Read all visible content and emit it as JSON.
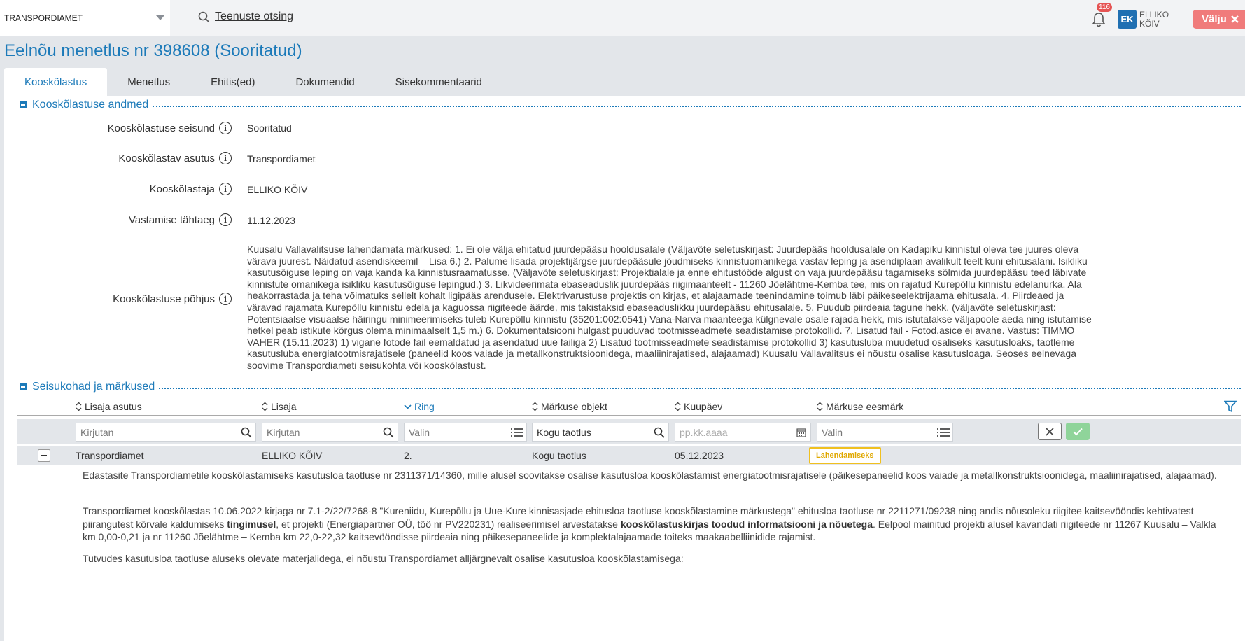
{
  "topbar": {
    "organization": "TRANSPORDIAMET",
    "search_label": "Teenuste otsing",
    "notifications_count": "116",
    "avatar_initials": "EK",
    "user_first": "ELLIKO",
    "user_last": "KÕIV",
    "logout_label": "Välju"
  },
  "page": {
    "title": "Eelnõu menetlus nr 398608 (Sooritatud)"
  },
  "tabs": [
    {
      "label": "Kooskõlastus",
      "active": true
    },
    {
      "label": "Menetlus"
    },
    {
      "label": "Ehitis(ed)"
    },
    {
      "label": "Dokumendid"
    },
    {
      "label": "Sisekommentaarid"
    }
  ],
  "section1": {
    "title": "Kooskõlastuse andmed",
    "fields": [
      {
        "label": "Kooskõlastuse seisund",
        "value": "Sooritatud"
      },
      {
        "label": "Kooskõlastav asutus",
        "value": "Transpordiamet"
      },
      {
        "label": "Kooskõlastaja",
        "value": "ELLIKO KÕIV"
      },
      {
        "label": "Vastamise tähtaeg",
        "value": "11.12.2023"
      },
      {
        "label": "Kooskõlastuse põhjus",
        "value": "Kuusalu Vallavalitsuse lahendamata märkused: 1. Ei ole välja ehitatud juurdepääsu hooldusalale (Väljavõte seletuskirjast: Juurdepääs hooldusalale on Kadapiku kinnistul oleva tee juures oleva värava juurest. Näidatud asendiskeemil – Lisa 6.) 2. Palume lisada projektijärgse juurdepääsule jõudmiseks kinnistuomanikega vastav leping ja asendiplaan avalikult teelt kuni ehitusalani. Isikliku kasutusõiguse leping on vaja kanda ka kinnistusraamatusse. (Väljavõte seletuskirjast: Projektialale ja enne ehitustööde algust on vaja juurdepääsu tagamiseks sõlmida juurdepääsu teed läbivate kinnistute omanikega isikliku kasutusõiguse lepingud.) 3. Likvideerimata ebaseaduslik juurdepääs riigimaanteelt - 11260 Jõelähtme-Kemba tee, mis on rajatud Kurepõllu kinnistu edelanurka. Ala heakorrastada ja teha võimatuks sellelt kohalt ligipääs arendusele. Elektrivarustuse projektis on kirjas, et alajaamade teenindamine toimub läbi päikeseelektrijaama ehitusala. 4. Piirdeaed ja väravad rajamata Kurepõllu kinnistu edela ja kaguossa riigiteede äärde, mis takistaksid ebaseaduslikku juurdepääsu ehitusalale. 5. Puudub piirdeaia tagune hekk. (väljavõte seletuskirjast: Potentsiaalse visuaalse häiringu minimeerimiseks tuleb Kurepõllu kinnistu (35201:002:0541) Vana-Narva maanteega külgnevale osale rajada hekk, mis istutatakse väljapoole aeda ning istutamise hetkel peab istikute kõrgus olema minimaalselt 1,5 m.) 6. Dokumentatsiooni hulgast puuduvad tootmisseadmete seadistamise protokollid. 7. Lisatud fail - Fotod.asice ei avane. Vastus: TIMMO VAHER (15.11.2023) 1) vigane fotode fail eemaldatud ja asendatud uue failiga 2) Lisatud tootmisseadmete seadistamise protokollid 3) kasutusluba muudetud osaliseks kasutusloaks, taotleme kasutusluba energiatootmisrajatisele (paneelid koos vaiade ja metallkonstruktsioonidega, maaliinirajatised, alajaamad) Kuusalu Vallavalitsus ei nõustu osalise kasutusloaga. Seoses eelnevaga soovime Transpordiameti seisukohta või kooskõlastust."
      }
    ]
  },
  "section2": {
    "title": "Seisukohad ja märkused",
    "columns": [
      "Lisaja asutus",
      "Lisaja",
      "Ring",
      "Märkuse objekt",
      "Kuupäev",
      "Märkuse eesmärk"
    ],
    "filters": [
      "Kirjutan",
      "Kirjutan",
      "Valin",
      "Kogu taotlus",
      "pp.kk.aaaa",
      "Valin"
    ],
    "row": {
      "institution": "Transpordiamet",
      "author": "ELLIKO KÕIV",
      "round": "2.",
      "object": "Kogu taotlus",
      "date": "05.12.2023",
      "purpose": "Lahendamiseks"
    },
    "detail_p1": "Edastasite Transpordiametile kooskõlastamiseks kasutusloa taotluse nr 2311371/14360, mille alusel soovitakse osalise kasutusloa kooskõlastamist energiatootmisrajatisele (päikesepaneelid koos vaiade ja metallkonstruktsioonidega, maaliinirajatised, alajaamad).",
    "detail_p2_a": "Transpordiamet kooskõlastas 10.06.2022 kirjaga nr 7.1-2/22/7268-8 \"Kureniidu, Kurepõllu ja Uue-Kure kinnisasjade ehitusloa taotluse kooskõlastamine märkustega\" ehitusloa taotluse nr 2211271/09238 ning andis nõusoleku riigitee kaitsevööndis kehtivatest piirangutest kõrvale kaldumiseks ",
    "detail_p2_b": "tingimusel",
    "detail_p2_c": ", et projekti (Energiapartner OÜ, töö nr PV220231) realiseerimisel arvestatakse ",
    "detail_p2_d": "kooskõlastuskirjas toodud informatsiooni ja nõuetega",
    "detail_p2_e": ". Eelpool mainitud projekti alusel kavandati riigiteede nr 11267 Kuusalu – Valkla km 0,00-0,21 ja nr 11260 Jõelähtme – Kemba km 22,0-22,32 kaitsevööndisse piirdeaia ning päikesepaneelide ja komplektalajaamade toiteks maakaabelliinidide rajamist.",
    "detail_p3": "Tutvudes kasutusloa taotluse aluseks olevate materjalidega, ei nõustu Transpordiamet alljärgnevalt osalise kasutusloa kooskõlastamisega:"
  }
}
